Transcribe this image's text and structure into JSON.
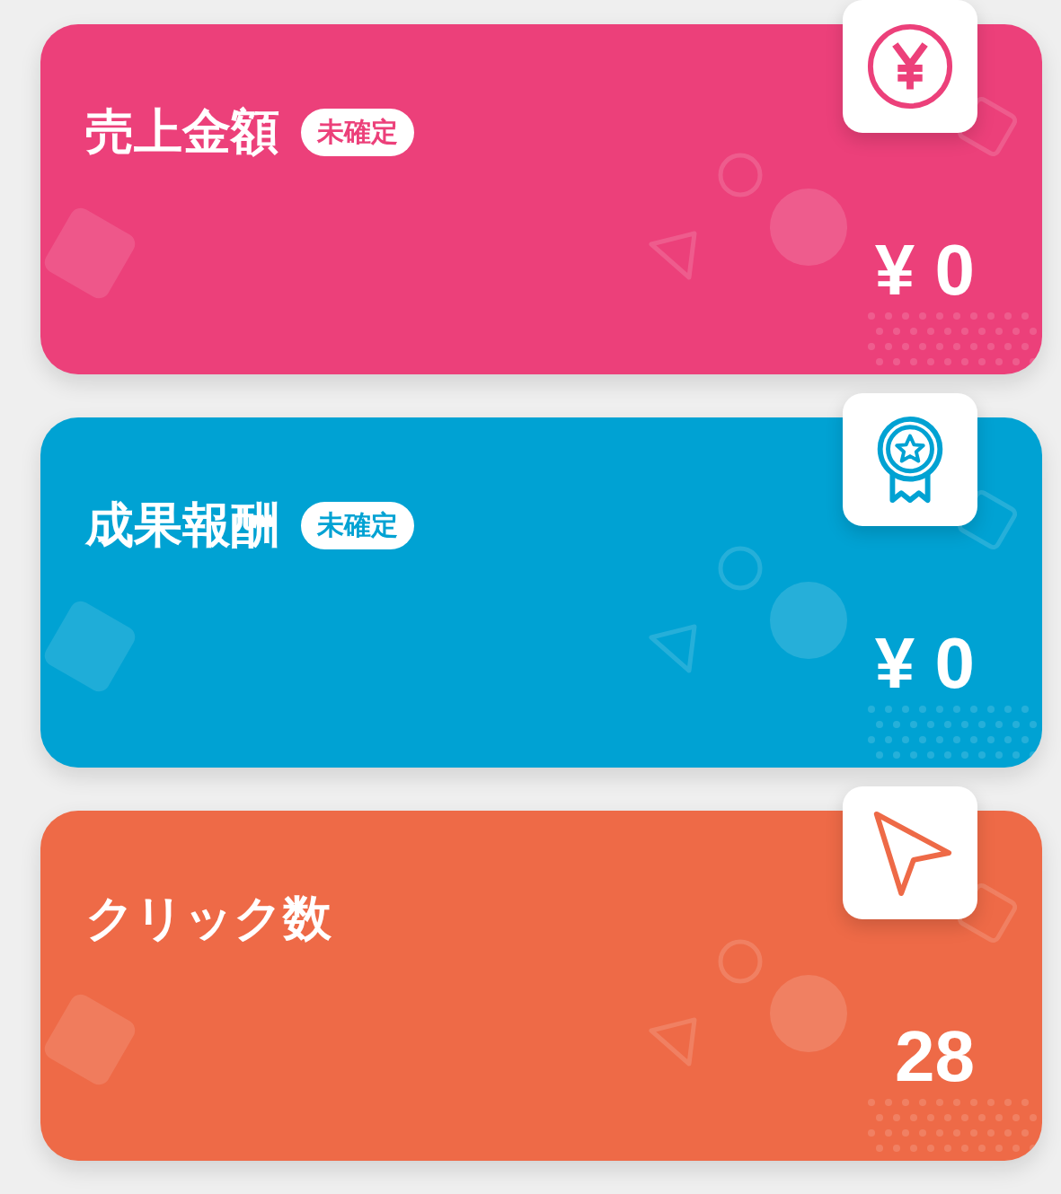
{
  "cards": [
    {
      "kind": "yen",
      "title": "売上金額",
      "badge": "未確定",
      "value": "¥ 0",
      "color": "#ec407a"
    },
    {
      "kind": "medal",
      "title": "成果報酬",
      "badge": "未確定",
      "value": "¥ 0",
      "color": "#00a2d3"
    },
    {
      "kind": "cursor",
      "title": "クリック数",
      "value": "28",
      "color": "#ee6a47"
    }
  ]
}
